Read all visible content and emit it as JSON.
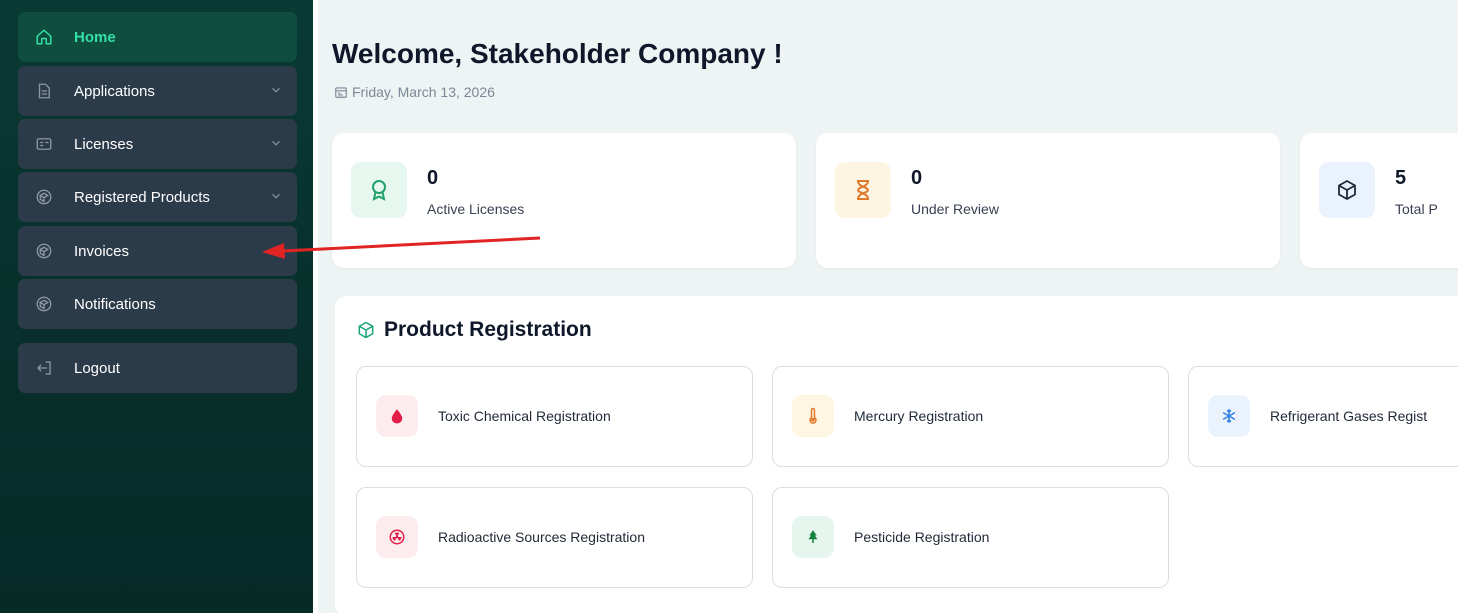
{
  "sidebar": {
    "items": [
      {
        "label": "Home",
        "icon": "home-icon",
        "active": true,
        "expandable": false
      },
      {
        "label": "Applications",
        "icon": "document-icon",
        "active": false,
        "expandable": true
      },
      {
        "label": "Licenses",
        "icon": "id-card-icon",
        "active": false,
        "expandable": true
      },
      {
        "label": "Registered Products",
        "icon": "box-icon",
        "active": false,
        "expandable": true
      },
      {
        "label": "Invoices",
        "icon": "box-icon",
        "active": false,
        "expandable": false
      },
      {
        "label": "Notifications",
        "icon": "box-icon",
        "active": false,
        "expandable": false
      }
    ],
    "logout_label": "Logout"
  },
  "header": {
    "welcome": "Welcome, Stakeholder Company !",
    "date": "Friday, March 13, 2026"
  },
  "stats": [
    {
      "value": "0",
      "label": "Active Licenses",
      "icon": "award-icon",
      "color": "#e6f7ef"
    },
    {
      "value": "0",
      "label": "Under Review",
      "icon": "hourglass-icon",
      "color": "#fdf5e2"
    },
    {
      "value": "5",
      "label": "Total P",
      "icon": "package-icon",
      "color": "#eaf2fd"
    }
  ],
  "product_registration": {
    "title": "Product Registration",
    "items": [
      {
        "label": "Toxic Chemical Registration",
        "icon": "droplet-icon"
      },
      {
        "label": "Mercury Registration",
        "icon": "thermometer-icon"
      },
      {
        "label": "Refrigerant Gases Regist",
        "icon": "snowflake-icon"
      },
      {
        "label": "Radioactive Sources Registration",
        "icon": "radiation-icon"
      },
      {
        "label": "Pesticide Registration",
        "icon": "tree-icon"
      }
    ]
  },
  "colors": {
    "sidebar_bg": "#093a34",
    "nav_item_bg": "#2c3b4a",
    "active_accent": "#35e0a4",
    "annotation_arrow": "#e02424"
  }
}
